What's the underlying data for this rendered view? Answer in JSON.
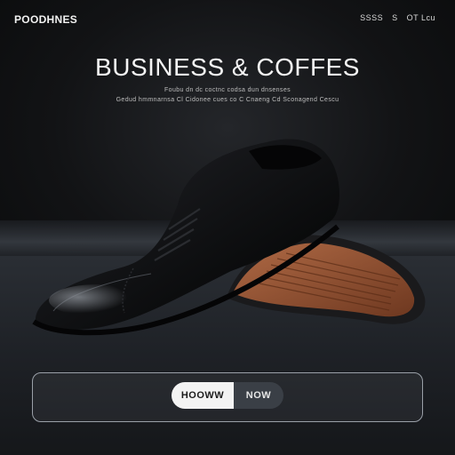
{
  "header": {
    "brand": "POODHNES",
    "nav": [
      "SSSS",
      "S",
      "OT Lcu"
    ]
  },
  "hero": {
    "title": "BUSINESS & COFFES",
    "subtitle_line1": "Foubu dn dc coctnc codsa dun dnsenses",
    "subtitle_line2": "Gedud hmmnarnsa Cl Cidonee cues co C Cnaeng Cd Sconagend Cescu"
  },
  "cta": {
    "left_label": "HOOWW",
    "right_label": "NOW"
  },
  "colors": {
    "background": "#0c0d0f",
    "shoe_leather": "#111214",
    "sole": "#8a4a2c"
  }
}
